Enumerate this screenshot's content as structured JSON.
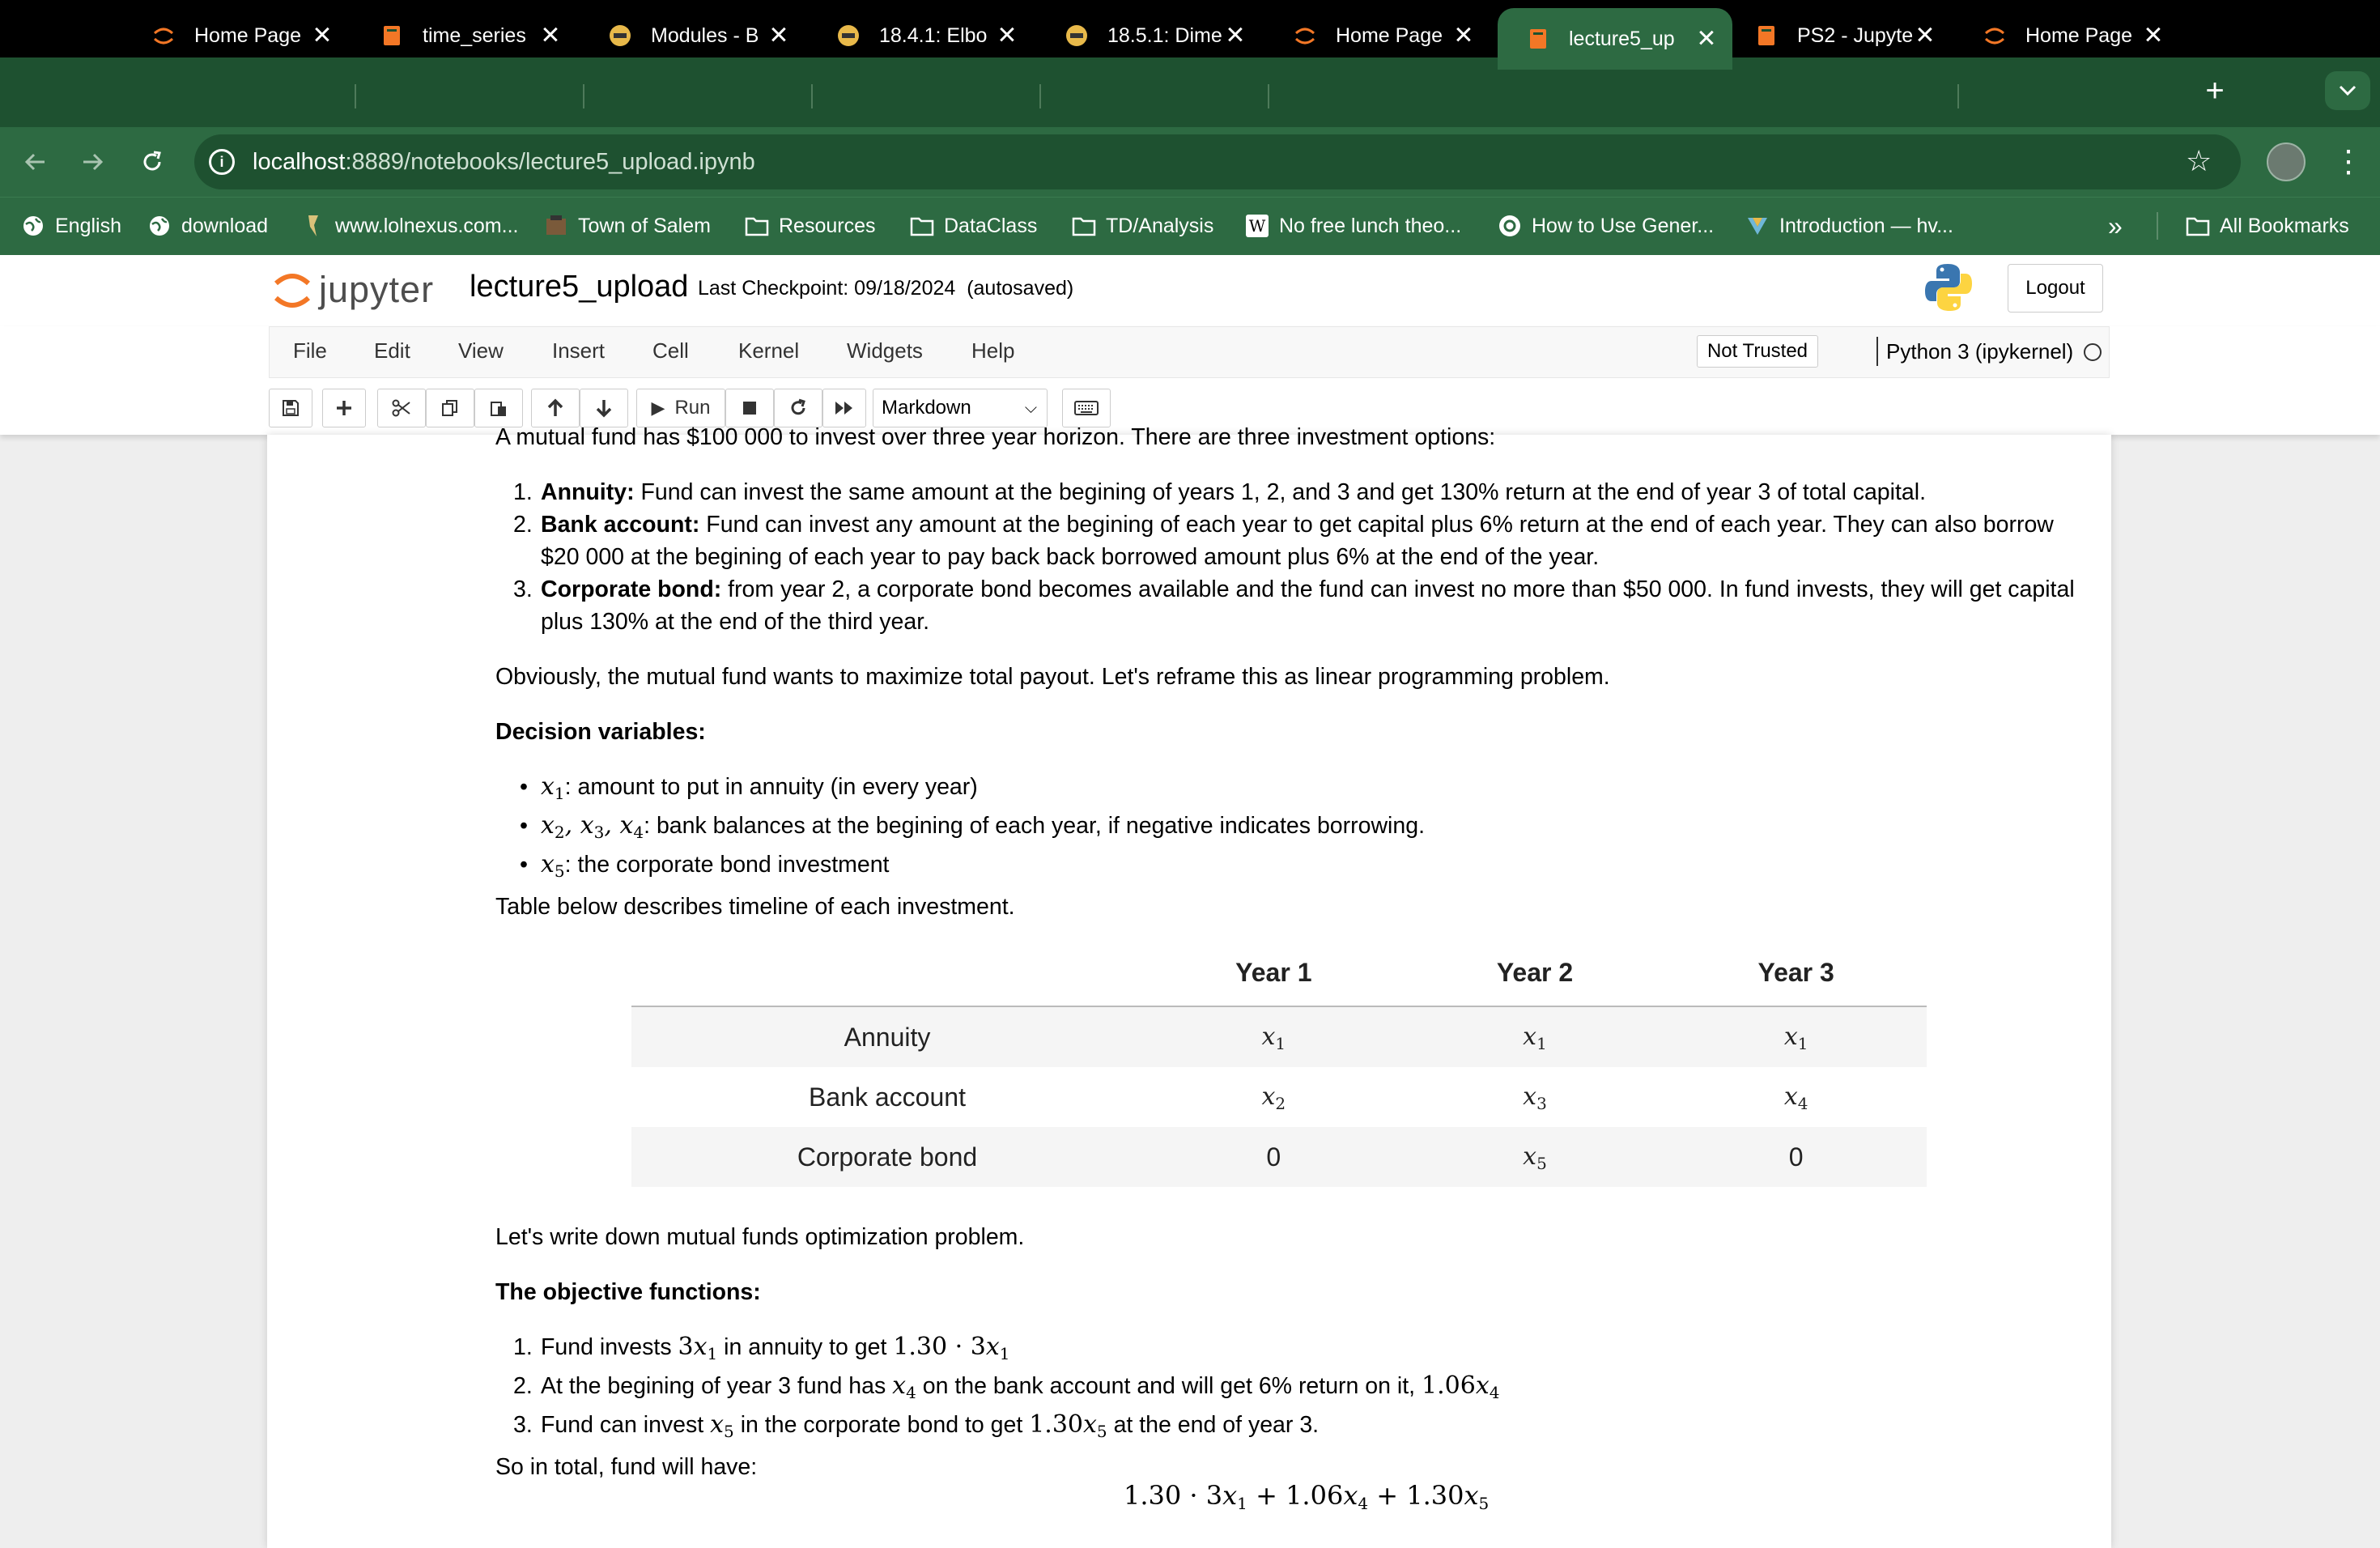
{
  "browser": {
    "tabs": [
      {
        "title": "Home Page",
        "icon": "jupyter-icon",
        "active": false
      },
      {
        "title": "time_series",
        "icon": "notebook-icon",
        "active": false
      },
      {
        "title": "Modules - B",
        "icon": "canvas-icon",
        "active": false
      },
      {
        "title": "18.4.1: Elbo",
        "icon": "canvas-icon",
        "active": false
      },
      {
        "title": "18.5.1: Dime",
        "icon": "canvas-icon",
        "active": false
      },
      {
        "title": "Home Page",
        "icon": "jupyter-icon",
        "active": false
      },
      {
        "title": "lecture5_up",
        "icon": "notebook-icon",
        "active": true
      },
      {
        "title": "PS2 - Jupyte",
        "icon": "notebook-icon",
        "active": false
      },
      {
        "title": "Home Page",
        "icon": "jupyter-icon",
        "active": false
      }
    ],
    "url_host": "localhost",
    "url_path": ":8889/notebooks/lecture5_upload.ipynb",
    "bookmarks": [
      {
        "label": "English",
        "icon": "globe-icon"
      },
      {
        "label": "download",
        "icon": "globe-icon"
      },
      {
        "label": "www.lolnexus.com...",
        "icon": "lolnexus-icon"
      },
      {
        "label": "Town of Salem",
        "icon": "salem-icon"
      },
      {
        "label": "Resources",
        "icon": "folder-icon"
      },
      {
        "label": "DataClass",
        "icon": "folder-icon"
      },
      {
        "label": "TD/Analysis",
        "icon": "folder-icon"
      },
      {
        "label": "No free lunch theo...",
        "icon": "wikipedia-icon"
      },
      {
        "label": "How to Use Gener...",
        "icon": "openai-icon"
      },
      {
        "label": "Introduction — hv...",
        "icon": "hv-icon"
      }
    ],
    "overflow_label": "»",
    "all_bookmarks_label": "All Bookmarks"
  },
  "jupyter": {
    "logo_text": "jupyter",
    "notebook_name": "lecture5_upload",
    "checkpoint": "Last Checkpoint: 09/18/2024",
    "autosaved": "(autosaved)",
    "logout_label": "Logout",
    "menus": [
      "File",
      "Edit",
      "View",
      "Insert",
      "Cell",
      "Kernel",
      "Widgets",
      "Help"
    ],
    "trust_label": "Not Trusted",
    "kernel_label": "Python 3 (ipykernel)",
    "run_label": "Run",
    "cell_type": "Markdown"
  },
  "notebook": {
    "intro_cut": "A mutual fund has $100 000 to invest over three year horizon. There are three investment options:",
    "options": [
      {
        "bold": "Annuity:",
        "text": " Fund can invest the same amount at the begining of years 1, 2, and 3 and get 130% return at the end of year 3 of total capital."
      },
      {
        "bold": "Bank account:",
        "text": " Fund can invest any amount at the begining of each year to get capital plus 6% return at the end of each year. They can also borrow",
        "text2": "$20 000 at the begining of each year to pay back back borrowed amount plus 6% at the end of the year."
      },
      {
        "bold": "Corporate bond:",
        "text": " from year 2, a corporate bond becomes available and the fund can invest no more than $50 000. In fund invests, they will get capital",
        "text2": "plus 130% at the end of the third year."
      }
    ],
    "para_obvious": "Obviously, the mutual fund wants to maximize total payout. Let's reframe this as linear programming problem.",
    "decision_heading": "Decision variables:",
    "decision_vars": [
      ": amount to put in annuity (in every year)",
      ": bank balances at the begining of each year, if negative indicates borrowing.",
      ": the corporate bond investment"
    ],
    "table_intro": "Table below describes timeline of each investment.",
    "table": {
      "headers": [
        "",
        "Year 1",
        "Year 2",
        "Year 3"
      ],
      "rows": [
        {
          "label": "Annuity",
          "cells": [
            "x1",
            "x1",
            "x1"
          ]
        },
        {
          "label": "Bank account",
          "cells": [
            "x2",
            "x3",
            "x4"
          ]
        },
        {
          "label": "Corporate bond",
          "cells": [
            "0",
            "x5",
            "0"
          ]
        }
      ]
    },
    "write_down": "Let's write down mutual funds optimization problem.",
    "objective_heading": "The objective functions:",
    "objective_items": [
      {
        "a": "Fund invests ",
        "b": " in annuity to get "
      },
      {
        "a": "At the begining of year 3 fund has ",
        "b": " on the bank account and will get 6% return on it, "
      },
      {
        "a": "Fund can invest ",
        "b": " in the corporate bond to get ",
        "c": " at the end of year 3."
      }
    ],
    "total_text": "So in total, fund will have:"
  }
}
